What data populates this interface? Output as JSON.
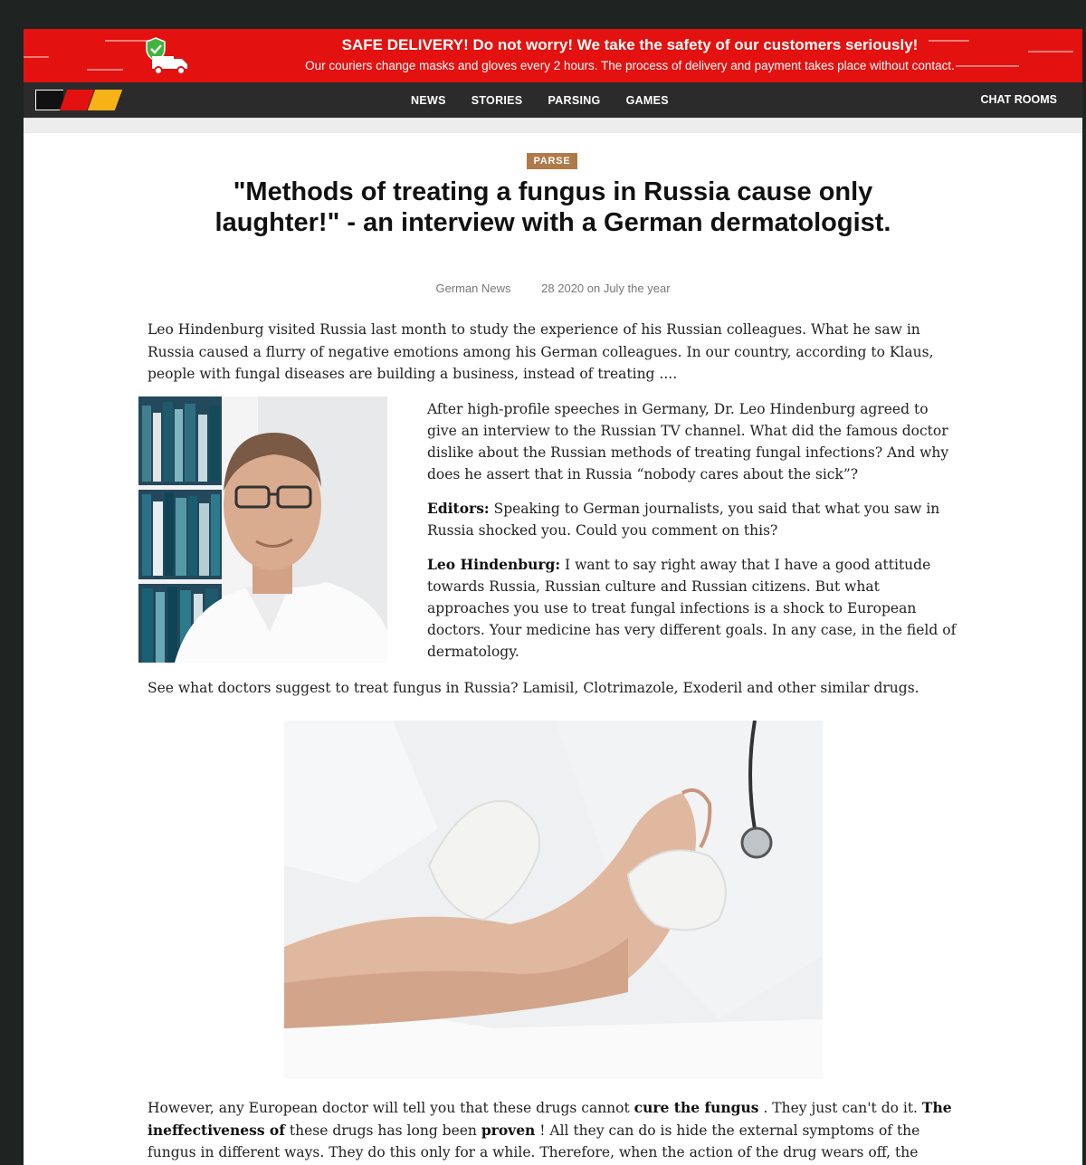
{
  "banner": {
    "headline": "SAFE DELIVERY! Do not worry! We take the safety of our customers seriously!",
    "subline": "Our couriers change masks and gloves every 2 hours. The process of delivery and payment takes place without contact."
  },
  "nav": {
    "links": [
      "NEWS",
      "STORIES",
      "PARSING",
      "GAMES"
    ],
    "chat": "CHAT ROOMS"
  },
  "article": {
    "tag": "PARSE",
    "title": "\"Methods of treating a fungus in Russia cause only laughter!\" - an interview with a German dermatologist.",
    "source": "German News",
    "date": "28 2020 on July the year",
    "lead": "Leo Hindenburg visited Russia last month to study the experience of his Russian colleagues. What he saw in Russia caused a flurry of negative emotions among his German colleagues. In our country, according to Klaus, people with fungal diseases are building a business, instead of treating ....",
    "intro": "After high-profile speeches in Germany, Dr. Leo Hindenburg agreed to give an interview to the Russian TV channel. What did the famous doctor dislike about the Russian methods of treating fungal infections? And why does he assert that in Russia “nobody cares about the sick”?",
    "q1_label": "Editors:",
    "q1_text": " Speaking to German journalists, you said that what you saw in Russia shocked you. Could you comment on this?",
    "a1_label": "Leo Hindenburg:",
    "a1_text": " I want to say right away that I have a good attitude towards Russia, Russian culture and Russian citizens. But what approaches you use to treat fungal infections is a shock to European doctors. Your medicine has very different goals. In any case, in the field of dermatology.",
    "drugs": "See what doctors suggest to treat fungus in Russia? Lamisil, Clotrimazole, Exoderil and other similar drugs.",
    "closing": {
      "p1": "However, any European doctor will tell you that these drugs cannot ",
      "b1": "cure the fungus",
      "p2": " . They just can't do it. ",
      "b2": "The ineffectiveness of",
      "p3": " these drugs has long been ",
      "b3": "proven",
      "p4": " ! All they can do is hide the external symptoms of the fungus in different ways. They do this only for a while. Therefore, when the action of the drug wears off, the"
    }
  },
  "colors": {
    "banner": "#e3110f",
    "nav": "#2b2b2b",
    "tag": "#b07a48",
    "page_bg": "#1f2322"
  }
}
